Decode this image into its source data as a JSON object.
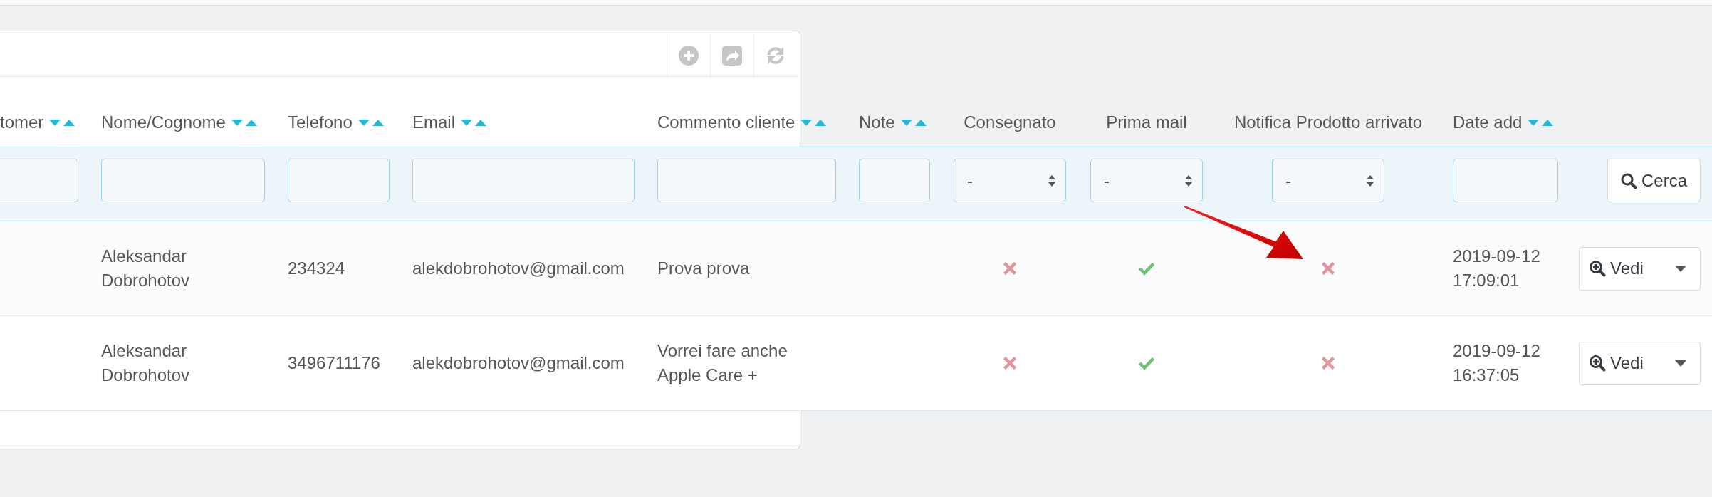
{
  "toolbar_buttons": [
    {
      "kind": "add"
    },
    {
      "kind": "export"
    },
    {
      "kind": "refresh"
    }
  ],
  "columns": [
    {
      "label": "tomer",
      "sortable": true,
      "kind": "text"
    },
    {
      "label": "Nome/Cognome",
      "sortable": true,
      "kind": "text"
    },
    {
      "label": "Telefono",
      "sortable": true,
      "kind": "text"
    },
    {
      "label": "Email",
      "sortable": true,
      "kind": "text"
    },
    {
      "label": "Commento cliente",
      "sortable": true,
      "kind": "text"
    },
    {
      "label": "Note",
      "sortable": true,
      "kind": "text"
    },
    {
      "label": "Consegnato",
      "sortable": false,
      "kind": "status"
    },
    {
      "label": "Prima mail",
      "sortable": false,
      "kind": "status"
    },
    {
      "label": "Notifica Prodotto arrivato",
      "sortable": false,
      "kind": "status"
    },
    {
      "label": "Date add",
      "sortable": true,
      "kind": "text"
    }
  ],
  "filters": [
    {
      "kind": "text"
    },
    {
      "kind": "text"
    },
    {
      "kind": "text"
    },
    {
      "kind": "text"
    },
    {
      "kind": "text"
    },
    {
      "kind": "text"
    },
    {
      "kind": "select",
      "value": "-"
    },
    {
      "kind": "select",
      "value": "-"
    },
    {
      "kind": "select",
      "value": "-"
    },
    {
      "kind": "text"
    }
  ],
  "search_button": {
    "label": "Cerca"
  },
  "rows": [
    {
      "nome_cognome": "Aleksandar Dobrohotov",
      "telefono": "234324",
      "email": "alekdobrohotov@gmail.com",
      "commento_cliente": "Prova prova",
      "consegnato": false,
      "prima_mail": true,
      "notifica_prodotto_arrivato": false,
      "date_add": "2019-09-12 17:09:01",
      "action": {
        "label": "Vedi"
      }
    },
    {
      "nome_cognome": "Aleksandar Dobrohotov",
      "telefono": "3496711176",
      "email": "alekdobrohotov@gmail.com",
      "commento_cliente": "Vorrei fare anche Apple Care +",
      "consegnato": false,
      "prima_mail": true,
      "notifica_prodotto_arrivato": false,
      "date_add": "2019-09-12 16:37:05",
      "action": {
        "label": "Vedi"
      }
    }
  ],
  "annotation": {
    "kind": "arrow"
  }
}
